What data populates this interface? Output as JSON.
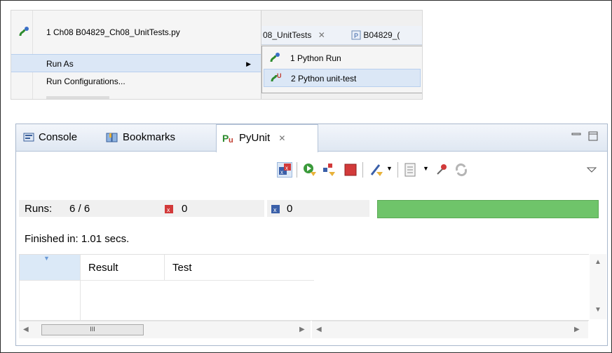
{
  "context_menu": {
    "recent_item": "1 Ch08 B04829_Ch08_UnitTests.py",
    "run_as": "Run As",
    "run_configurations": "Run Configurations...",
    "submenu": [
      "1 Python Run",
      "2 Python unit-test"
    ]
  },
  "editor_tabs": [
    "08_UnitTests",
    "B04829_("
  ],
  "view": {
    "tabs": [
      {
        "label": "Console",
        "icon": "console-icon"
      },
      {
        "label": "Bookmarks",
        "icon": "bookmarks-icon"
      },
      {
        "label": "PyUnit",
        "icon": "pyunit-icon"
      }
    ],
    "runs_label": "Runs:",
    "runs_value": "6 / 6",
    "errors_value": "0",
    "failures_value": "0",
    "finished": "Finished in: 1.01 secs.",
    "columns": [
      "Result",
      "Test"
    ],
    "progress_color": "#6fc46a",
    "progress_fraction": 1.0
  }
}
